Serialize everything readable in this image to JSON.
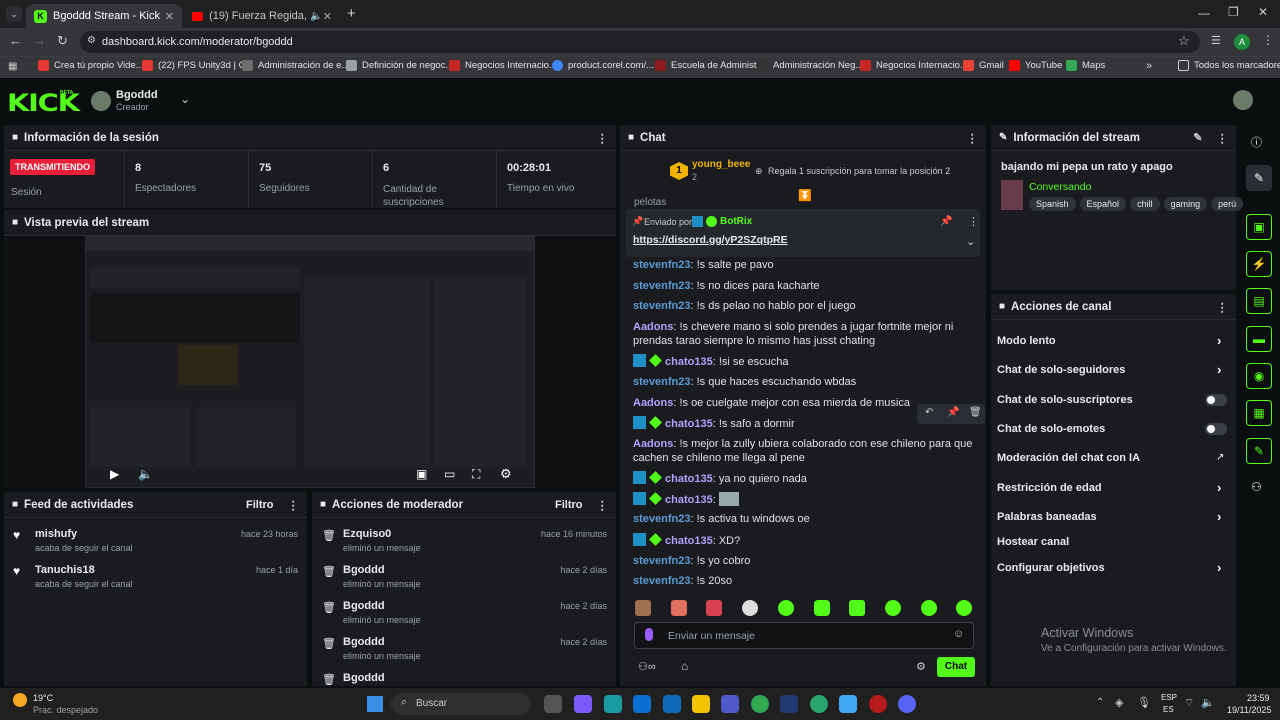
{
  "browser": {
    "tabs": [
      {
        "title": "Bgoddd Stream - Kick Dashboa"
      },
      {
        "title": "(19) Fuerza Regida, Grupo F"
      }
    ],
    "url": "dashboard.kick.com/moderator/bgoddd",
    "profile": "A"
  },
  "bookmarks": [
    {
      "label": "Crea tú propio Vide..."
    },
    {
      "label": "(22) FPS Unity3d | C..."
    },
    {
      "label": "Administración de e..."
    },
    {
      "label": "Definición de negoc..."
    },
    {
      "label": "Negocios Internacio..."
    },
    {
      "label": "product.corel.com/..."
    },
    {
      "label": "Escuela de Administ..."
    },
    {
      "label": "Administración Neg..."
    },
    {
      "label": "Negocios Internacio..."
    },
    {
      "label": "Gmail"
    },
    {
      "label": "YouTube"
    },
    {
      "label": "Maps"
    }
  ],
  "bookmarks_all": "Todos los marcadores",
  "header": {
    "logo": "KICK",
    "beta": "BETA",
    "channel": "Bgoddd",
    "role": "Creador"
  },
  "session": {
    "title": "Información de la sesión",
    "status": "TRANSMITIENDO",
    "status_label": "Sesión",
    "stats": [
      {
        "value": "8",
        "label": "Espectadores"
      },
      {
        "value": "75",
        "label": "Seguidores"
      },
      {
        "value": "6",
        "label": "Cantidad de suscripciones"
      },
      {
        "value": "00:28:01",
        "label": "Tiempo en vivo"
      }
    ]
  },
  "preview": {
    "title": "Vista previa del stream"
  },
  "feed": {
    "title": "Feed de actividades",
    "filter": "Filtro",
    "items": [
      {
        "name": "mishufy",
        "action": "acaba de seguir el canal",
        "time": "hace 23 horas"
      },
      {
        "name": "Tanuchis18",
        "action": "acaba de seguir el canal",
        "time": "hace 1 día"
      }
    ]
  },
  "modactions": {
    "title": "Acciones de moderador",
    "filter": "Filtro",
    "items": [
      {
        "name": "Ezquiso0",
        "action": "eliminó un mensaje",
        "time": "hace 16 minutos"
      },
      {
        "name": "Bgoddd",
        "action": "eliminó un mensaje",
        "time": "hace 2 días"
      },
      {
        "name": "Bgoddd",
        "action": "eliminó un mensaje",
        "time": "hace 2 días"
      },
      {
        "name": "Bgoddd",
        "action": "eliminó un mensaje",
        "time": "hace 2 días"
      },
      {
        "name": "Bgoddd",
        "action": ""
      }
    ]
  },
  "chat": {
    "title": "Chat",
    "top_user": "young_beee",
    "top_rank": "1",
    "top_count": "2",
    "gift_text": "Regala 1 suscripción para tomar la posición 2",
    "cut_text": "pelotas",
    "pinned_by": "Enviado por",
    "pinned_user": "BotRix",
    "pinned_link": "https://discord.gg/yP2SZqtpRE",
    "messages": [
      {
        "user": "stevenfn23",
        "text": ": !s salte pe pavo",
        "color": "blue",
        "badges": false
      },
      {
        "user": "stevenfn23",
        "text": ": !s no dices para kacharte",
        "color": "blue",
        "badges": false
      },
      {
        "user": "stevenfn23",
        "text": ": !s ds pelao no hablo por el juego",
        "color": "blue",
        "badges": false
      },
      {
        "user": "Aadons",
        "text": ": !s chevere mano si solo prendes a jugar fortnite mejor ni prendas tarao siempre lo mismo has jusst chating",
        "color": "purple",
        "badges": false
      },
      {
        "user": "chato135",
        "text": ": !si se escucha",
        "color": "purple",
        "badges": true
      },
      {
        "user": "stevenfn23",
        "text": ": !s que haces escuchando wbdas",
        "color": "blue",
        "badges": false
      },
      {
        "user": "Aadons",
        "text": ": !s oe cuelgate mejor con esa mierda de musica",
        "color": "purple",
        "badges": false
      },
      {
        "user": "chato135",
        "text": ": !s safo a dormir",
        "color": "purple",
        "badges": true
      },
      {
        "user": "Aadons",
        "text": ": !s mejor la zully ubiera colaborado con ese chileno para que cachen se chileno me llega al pene",
        "color": "purple",
        "badges": false
      },
      {
        "user": "chato135",
        "text": ": ya no quiero nada",
        "color": "purple",
        "badges": true
      },
      {
        "user": "chato135",
        "text": ":",
        "color": "purple",
        "badges": true
      },
      {
        "user": "stevenfn23",
        "text": ": !s activa tu windows oe",
        "color": "blue",
        "badges": false
      },
      {
        "user": "chato135",
        "text": ": XD?",
        "color": "purple",
        "badges": true
      },
      {
        "user": "stevenfn23",
        "text": ": !s yo cobro",
        "color": "blue",
        "badges": false
      },
      {
        "user": "stevenfn23",
        "text": ": !s 20so",
        "color": "blue",
        "badges": false
      }
    ],
    "input_placeholder": "Enviar un mensaje",
    "send": "Chat"
  },
  "stream_info": {
    "title": "Información del stream",
    "stream_title": "bajando mi pepa un rato y apago",
    "category": "Conversando",
    "tags": [
      "Spanish",
      "Español",
      "chill",
      "gaming",
      "perú"
    ]
  },
  "channel_actions": {
    "title": "Acciones de canal",
    "items": [
      {
        "label": "Modo lento",
        "control": "chevron"
      },
      {
        "label": "Chat de solo-seguidores",
        "control": "chevron"
      },
      {
        "label": "Chat de solo-suscriptores",
        "control": "toggle"
      },
      {
        "label": "Chat de solo-emotes",
        "control": "toggle"
      },
      {
        "label": "Moderación del chat con IA",
        "control": "link"
      },
      {
        "label": "Restricción de edad",
        "control": "chevron"
      },
      {
        "label": "Palabras baneadas",
        "control": "chevron"
      },
      {
        "label": "Hostear canal",
        "control": "none"
      },
      {
        "label": "Configurar objetivos",
        "control": "chevron"
      }
    ]
  },
  "watermark": {
    "line1": "Activar Windows",
    "line2": "Ve a Configuración para activar Windows."
  },
  "taskbar": {
    "temp": "19°C",
    "weather": "Prac. despejado",
    "search": "Buscar",
    "lang1": "ESP",
    "lang2": "ES",
    "time": "23:59",
    "date": "19/11/2025"
  },
  "colors": {
    "accent": "#53fc18",
    "live": "#e91f3a",
    "panel": "#191b1f"
  }
}
